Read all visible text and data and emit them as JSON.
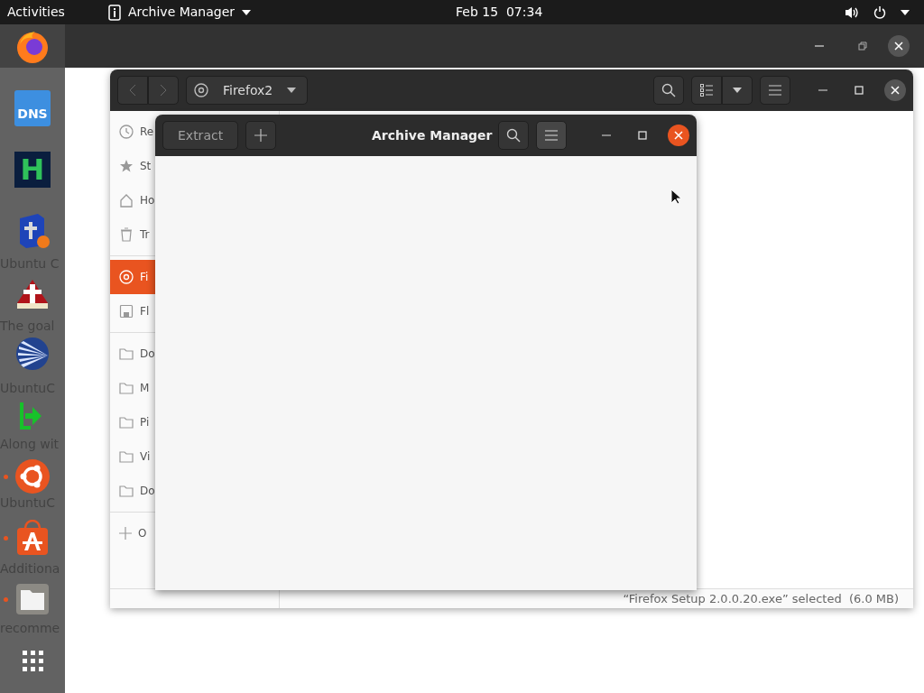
{
  "top_bar": {
    "activities": "Activities",
    "app_menu": "Archive Manager",
    "clock": "Feb 15  07:34"
  },
  "background_document": {
    "lines": [
      "Ubuntu C",
      "The goal",
      "UbuntuC",
      "Along wit",
      "UbuntuC",
      "Additiona",
      "recomme"
    ]
  },
  "dock": {
    "items": [
      {
        "kind": "firefox",
        "running": false
      },
      {
        "kind": "dns",
        "label": "DNS",
        "running": false
      },
      {
        "kind": "h",
        "label": "H",
        "running": false
      },
      {
        "kind": "bible",
        "running": false
      },
      {
        "kind": "redbook",
        "running": false
      },
      {
        "kind": "fan",
        "running": false
      },
      {
        "kind": "green",
        "running": false
      },
      {
        "kind": "ubuntu",
        "running": true
      },
      {
        "kind": "store",
        "running": true
      },
      {
        "kind": "files",
        "running": true
      },
      {
        "kind": "grid",
        "running": false
      }
    ]
  },
  "files_window": {
    "location": "Firefox2",
    "sidebar_sections": [
      {
        "items": [
          {
            "kind": "recent",
            "label": "Re",
            "selected": false
          },
          {
            "kind": "starred",
            "label": "St",
            "selected": false
          },
          {
            "kind": "home",
            "label": "Ho",
            "selected": false
          },
          {
            "kind": "trash",
            "label": "Tr",
            "selected": false
          }
        ]
      },
      {
        "items": [
          {
            "kind": "disc",
            "label": "Fi",
            "selected": true
          },
          {
            "kind": "drive",
            "label": "Fl",
            "selected": false
          }
        ]
      },
      {
        "items": [
          {
            "kind": "folder",
            "label": "Do",
            "selected": false
          },
          {
            "kind": "folder",
            "label": "M",
            "selected": false
          },
          {
            "kind": "folder",
            "label": "Pi",
            "selected": false
          },
          {
            "kind": "folder",
            "label": "Vi",
            "selected": false
          },
          {
            "kind": "folder",
            "label": "Do",
            "selected": false
          }
        ]
      },
      {
        "items": [
          {
            "kind": "other",
            "label": "O",
            "selected": false
          }
        ]
      }
    ],
    "status": "“Firefox Setup 2.0.0.20.exe” selected  (6.0 MB)"
  },
  "archive_window": {
    "title": "Archive Manager",
    "extract": {
      "label": "Extract",
      "disabled": true
    },
    "menu_pressed": true
  }
}
